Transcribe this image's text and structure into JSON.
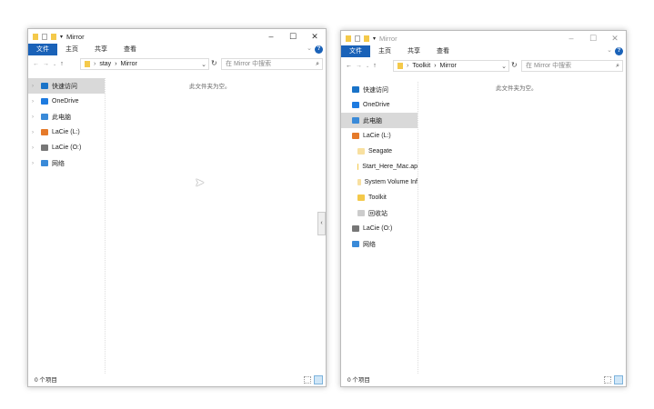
{
  "ribbon_tabs": [
    "文件",
    "主页",
    "共享",
    "查看"
  ],
  "left_window": {
    "title": "Mirror",
    "breadcrumb": [
      "stay",
      "Mirror"
    ],
    "search_placeholder": "在 Mirror 中搜索",
    "sidebar": [
      {
        "label": "快速访问",
        "icon": "star-icon",
        "color": "#1a73c8"
      },
      {
        "label": "OneDrive",
        "icon": "cloud-icon",
        "color": "#1e7be0"
      },
      {
        "label": "此电脑",
        "icon": "computer-icon",
        "color": "#3a8ad8"
      },
      {
        "label": "LaCie (L:)",
        "icon": "drive-icon",
        "color": "#e57a2a"
      },
      {
        "label": "LaCie (O:)",
        "icon": "drive-icon",
        "color": "#777"
      },
      {
        "label": "网络",
        "icon": "network-icon",
        "color": "#3a8ad8"
      }
    ],
    "empty_text": "此文件夹为空。",
    "status": "0 个项目"
  },
  "right_window": {
    "title": "Mirror",
    "breadcrumb": [
      "Toolkit",
      "Mirror"
    ],
    "search_placeholder": "在 Mirror 中搜索",
    "sidebar": [
      {
        "label": "快速访问",
        "icon": "star-icon",
        "color": "#1a73c8"
      },
      {
        "label": "OneDrive",
        "icon": "cloud-icon",
        "color": "#1e7be0"
      },
      {
        "label": "此电脑",
        "icon": "computer-icon",
        "color": "#3a8ad8"
      },
      {
        "label": "LaCie (L:)",
        "icon": "drive-icon",
        "color": "#e57a2a"
      },
      {
        "label": "Seagate",
        "icon": "folder-icon",
        "color": "#f8e0a0"
      },
      {
        "label": "Start_Here_Mac.ap",
        "icon": "folder-icon",
        "color": "#f4c94a"
      },
      {
        "label": "System Volume Inf",
        "icon": "folder-icon",
        "color": "#f8e0a0"
      },
      {
        "label": "Toolkit",
        "icon": "folder-icon",
        "color": "#f4c94a"
      },
      {
        "label": "回收站",
        "icon": "recycle-bin-icon",
        "color": "#ccc"
      },
      {
        "label": "LaCie (O:)",
        "icon": "drive-icon",
        "color": "#777"
      },
      {
        "label": "网络",
        "icon": "network-icon",
        "color": "#3a8ad8"
      }
    ],
    "empty_text": "此文件夹为空。",
    "status": "0 个项目"
  }
}
